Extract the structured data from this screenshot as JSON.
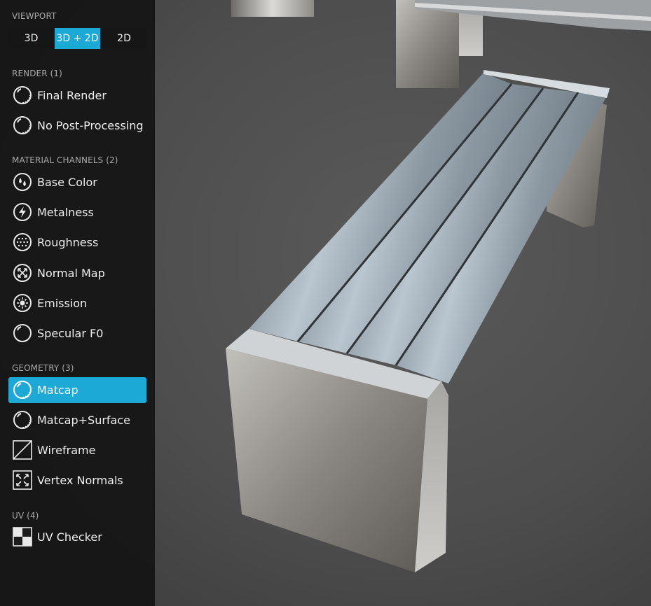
{
  "viewport_section": {
    "title": "VIEWPORT",
    "buttons": [
      {
        "label": "3D",
        "active": false
      },
      {
        "label": "3D + 2D",
        "active": true
      },
      {
        "label": "2D",
        "active": false
      }
    ]
  },
  "sections": [
    {
      "title": "RENDER (1)",
      "items": [
        {
          "label": "Final Render",
          "icon": "sphere-icon"
        },
        {
          "label": "No Post-Processing",
          "icon": "sphere-icon"
        }
      ]
    },
    {
      "title": "MATERIAL CHANNELS (2)",
      "items": [
        {
          "label": "Base Color",
          "icon": "droplet-icon"
        },
        {
          "label": "Metalness",
          "icon": "lightning-icon"
        },
        {
          "label": "Roughness",
          "icon": "dots-icon"
        },
        {
          "label": "Normal Map",
          "icon": "arrows-out-icon"
        },
        {
          "label": "Emission",
          "icon": "sun-icon"
        },
        {
          "label": "Specular F0",
          "icon": "sphere-icon"
        }
      ]
    },
    {
      "title": "GEOMETRY (3)",
      "items": [
        {
          "label": "Matcap",
          "icon": "sphere-icon",
          "selected": true
        },
        {
          "label": "Matcap+Surface",
          "icon": "sphere-icon"
        },
        {
          "label": "Wireframe",
          "icon": "wireframe-icon"
        },
        {
          "label": "Vertex Normals",
          "icon": "vertex-normals-icon"
        }
      ]
    },
    {
      "title": "UV (4)",
      "items": [
        {
          "label": "UV Checker",
          "icon": "checker-icon"
        }
      ]
    }
  ],
  "colors": {
    "accent": "#1ca9d6",
    "sidebar_bg": "#141416",
    "viewport_bg": "#4a4a4a"
  }
}
